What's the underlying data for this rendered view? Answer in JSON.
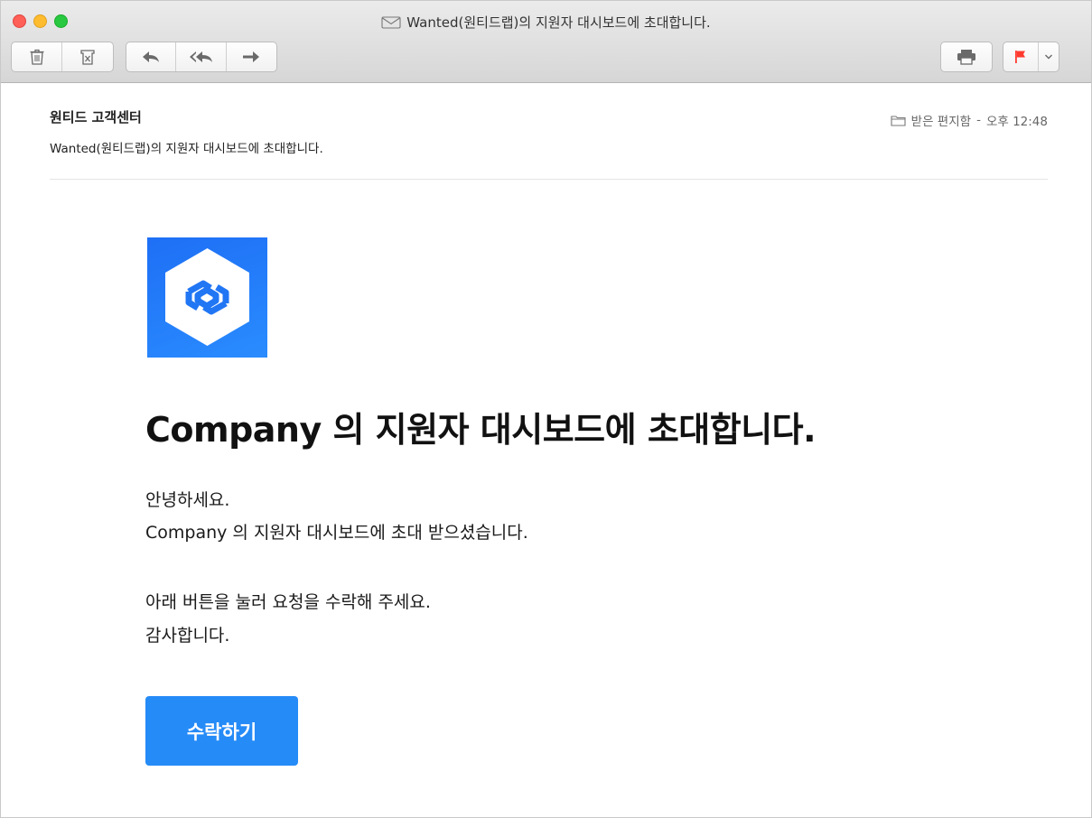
{
  "window": {
    "title": "Wanted(원티드랩)의 지원자 대시보드에 초대합니다."
  },
  "toolbar": {
    "delete_icon": "trash-icon",
    "junk_icon": "junk-icon",
    "reply_icon": "reply-icon",
    "reply_all_icon": "reply-all-icon",
    "forward_icon": "forward-icon",
    "print_icon": "printer-icon",
    "flag_icon": "flag-icon",
    "flag_color": "#ff3b30"
  },
  "email": {
    "sender": "원티드 고객센터",
    "subject": "Wanted(원티드랩)의 지원자 대시보드에 초대합니다.",
    "mailbox": "받은 편지함",
    "separator": "-",
    "time": "오후 12:48"
  },
  "body": {
    "headline": "Company 의 지원자 대시보드에 초대합니다.",
    "greeting": "안녕하세요.",
    "invited_line": "Company 의 지원자 대시보드에 초대 받으셨습니다.",
    "instruction": "아래 버튼을 눌러 요청을 수락해 주세요.",
    "thanks": "감사합니다.",
    "accept_button": "수락하기",
    "accent_color": "#258bf7"
  }
}
